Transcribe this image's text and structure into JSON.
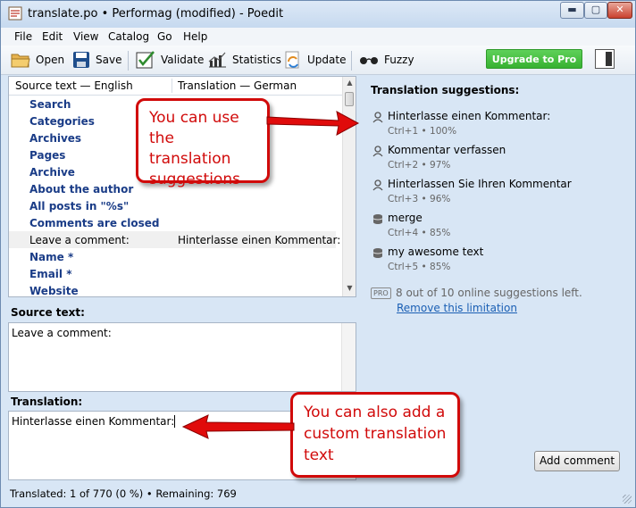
{
  "window": {
    "title": "translate.po • Performag (modified) - Poedit",
    "min": "▬",
    "max": "▢",
    "close": "✕"
  },
  "menu": [
    "File",
    "Edit",
    "View",
    "Catalog",
    "Go",
    "Help"
  ],
  "toolbar": {
    "open": "Open",
    "save": "Save",
    "validate": "Validate",
    "statistics": "Statistics",
    "update": "Update",
    "fuzzy": "Fuzzy",
    "upgrade": "Upgrade to Pro"
  },
  "list": {
    "col_source": "Source text — English",
    "col_translation": "Translation — German",
    "rows": [
      {
        "source": "Search",
        "translation": ""
      },
      {
        "source": "Categories",
        "translation": ""
      },
      {
        "source": "Archives",
        "translation": ""
      },
      {
        "source": "Pages",
        "translation": ""
      },
      {
        "source": "Archive",
        "translation": ""
      },
      {
        "source": "About the author",
        "translation": ""
      },
      {
        "source": "All posts in \"%s\"",
        "translation": ""
      },
      {
        "source": "Comments are closed",
        "translation": ""
      },
      {
        "source": "Leave a comment:",
        "translation": "Hinterlasse einen Kommentar:"
      },
      {
        "source": "Name *",
        "translation": ""
      },
      {
        "source": "Email *",
        "translation": ""
      },
      {
        "source": "Website",
        "translation": ""
      }
    ]
  },
  "source_panel": {
    "label": "Source text:",
    "text": "Leave a comment:"
  },
  "translation_panel": {
    "label": "Translation:",
    "text": "Hinterlasse einen Kommentar:"
  },
  "suggestions": {
    "title": "Translation suggestions:",
    "items": [
      {
        "text": "Hinterlasse einen Kommentar:",
        "meta": "Ctrl+1 • 100%",
        "icon": "person-icon"
      },
      {
        "text": "Kommentar verfassen",
        "meta": "Ctrl+2 • 97%",
        "icon": "person-icon"
      },
      {
        "text": "Hinterlassen Sie Ihren Kommentar",
        "meta": "Ctrl+3 • 96%",
        "icon": "person-icon"
      },
      {
        "text": "merge",
        "meta": "Ctrl+4 • 85%",
        "icon": "database-icon"
      },
      {
        "text": "my awesome text",
        "meta": "Ctrl+5 • 85%",
        "icon": "database-icon"
      }
    ],
    "pro_badge": "PRO",
    "pro_text": "8 out of 10 online suggestions left.",
    "pro_link": "Remove this limitation"
  },
  "add_comment": "Add comment",
  "status": "Translated: 1 of 770 (0 %)  •  Remaining: 769",
  "callouts": {
    "top": "You can use the translation suggestions",
    "bottom": "You can also add a custom translation text"
  },
  "colors": {
    "accent_red": "#d10a0a",
    "upgrade_green": "#37b131",
    "link_blue": "#1a5fb4",
    "source_blue": "#1a3c87"
  }
}
